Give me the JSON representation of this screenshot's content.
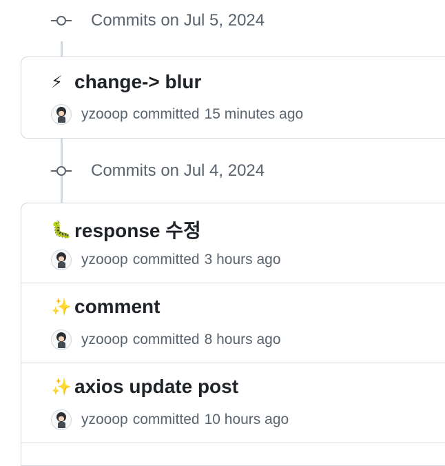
{
  "groups": [
    {
      "title": "Commits on Jul 5, 2024",
      "commits": [
        {
          "emoji": "⚡",
          "title": "change-> blur",
          "author": "yzooop",
          "verb": "committed",
          "time": "15 minutes ago"
        }
      ]
    },
    {
      "title": "Commits on Jul 4, 2024",
      "commits": [
        {
          "emoji": "🐛",
          "title": "response 수정",
          "author": "yzooop",
          "verb": "committed",
          "time": "3 hours ago"
        },
        {
          "emoji": "✨",
          "title": "comment",
          "author": "yzooop",
          "verb": "committed",
          "time": "8 hours ago"
        },
        {
          "emoji": "✨",
          "title": "axios update post",
          "author": "yzooop",
          "verb": "committed",
          "time": "10 hours ago"
        }
      ]
    }
  ],
  "icons": {
    "commit_node": "git-commit-icon",
    "avatar": "user-avatar"
  }
}
